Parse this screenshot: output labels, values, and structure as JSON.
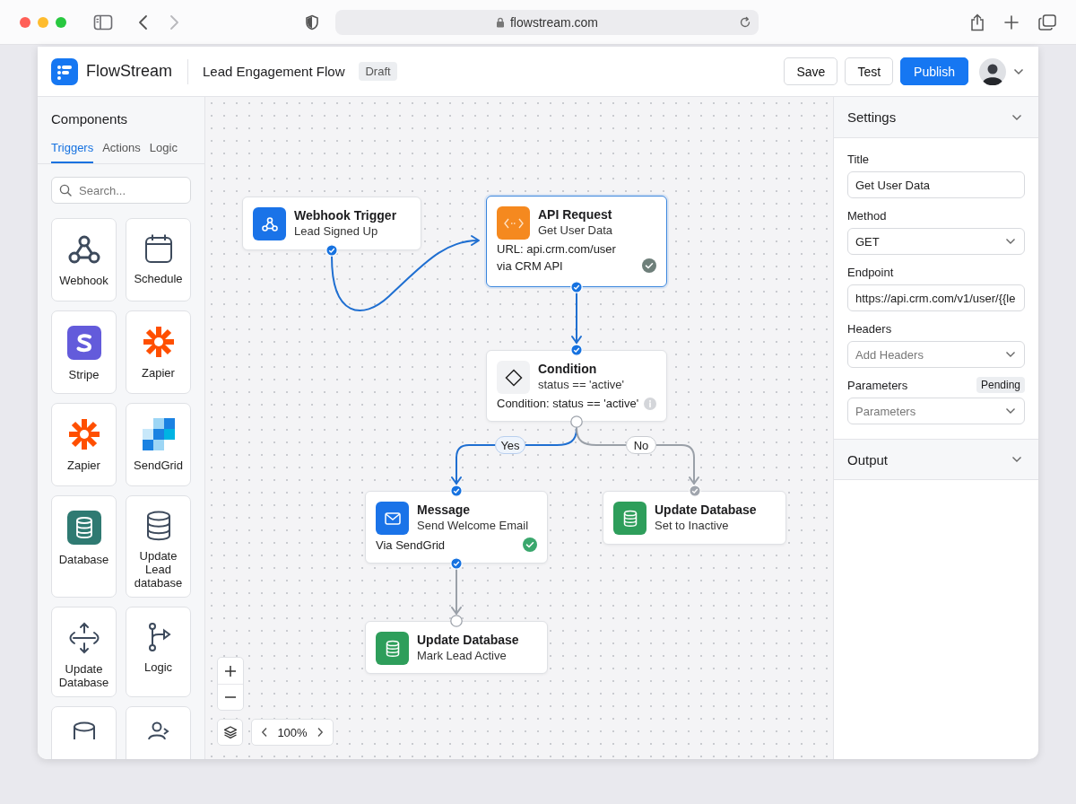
{
  "browser": {
    "url": "flowstream.com"
  },
  "app": {
    "name": "FlowStream",
    "flow_title": "Lead Engagement Flow",
    "status_badge": "Draft",
    "buttons": [
      {
        "label": "Save",
        "kind": "secondary"
      },
      {
        "label": "Test",
        "kind": "secondary"
      },
      {
        "label": "Publish",
        "kind": "primary"
      }
    ]
  },
  "components": {
    "title": "Components",
    "tabs": [
      {
        "label": "Triggers",
        "selected": true
      },
      {
        "label": "Actions",
        "selected": false
      },
      {
        "label": "Logic",
        "selected": false
      }
    ],
    "search": {
      "placeholder": "Search..."
    },
    "items": [
      {
        "label": "Webhook",
        "kind": "webhook"
      },
      {
        "label": "Schedule",
        "kind": "calendar"
      },
      {
        "label": "Stripe",
        "kind": "stripe"
      },
      {
        "label": "Zapier",
        "kind": "zapier"
      },
      {
        "label": "Zapier",
        "kind": "zapier"
      },
      {
        "label": "SendGrid",
        "kind": "sendgrid"
      },
      {
        "label": "Database",
        "kind": "database-tile"
      },
      {
        "label": "Update Lead database",
        "kind": "database"
      },
      {
        "label": "Update Database",
        "kind": "arrows"
      },
      {
        "label": "Logic",
        "kind": "branch"
      },
      {
        "kind": "cylinder"
      },
      {
        "kind": "user"
      }
    ]
  },
  "canvas": {
    "nodes": [
      {
        "title": "Webhook Trigger",
        "subtitle": "Lead Signed Up",
        "kind": "webhook",
        "color": "#1a73e8",
        "selected": false,
        "out_port": {
          "active": true,
          "checked": true
        }
      },
      {
        "title": "API Request",
        "subtitle": "Get User Data",
        "details": [
          "URL: api.crm.com/user",
          "via CRM API"
        ],
        "kind": "api",
        "color": "#f5891f",
        "status": {
          "kind": "check",
          "done": false
        },
        "selected": true,
        "out_port": {
          "active": true,
          "checked": true
        }
      },
      {
        "title": "Condition",
        "subtitle": "status == 'active'",
        "details": [
          "Condition: status == 'active'"
        ],
        "kind": "condition",
        "color": "#f1f2f4",
        "status": {
          "kind": "info"
        },
        "selected": false,
        "in_port": {
          "active": true,
          "checked": true
        },
        "out_port": {
          "active": false,
          "checked": false
        }
      },
      {
        "title": "Message",
        "subtitle": "Send Welcome Email",
        "details": [
          "Via SendGrid"
        ],
        "kind": "message",
        "color": "#1a73e8",
        "status": {
          "kind": "check",
          "done": true
        },
        "selected": false,
        "in_port": {
          "active": true,
          "checked": true
        },
        "out_port": {
          "active": true,
          "checked": true
        }
      },
      {
        "title": "Update Database",
        "subtitle": "Set to Inactive",
        "kind": "database",
        "color": "#2e9e5b",
        "selected": false,
        "in_port": {
          "active": false,
          "checked": true
        }
      },
      {
        "title": "Update Database",
        "subtitle": "Mark Lead Active",
        "kind": "database",
        "color": "#2e9e5b",
        "selected": false,
        "in_port": {
          "active": false,
          "checked": false
        }
      }
    ],
    "edges": [
      {
        "active": true
      },
      {
        "active": true
      },
      {
        "label": "Yes",
        "active": true
      },
      {
        "label": "No",
        "active": false
      },
      {
        "active": false
      }
    ],
    "zoom": "100%"
  },
  "settings": {
    "title": "Settings",
    "fields": [
      {
        "label": "Title",
        "kind": "input",
        "value": "Get User Data"
      },
      {
        "label": "Method",
        "kind": "select",
        "value": "GET"
      },
      {
        "label": "Endpoint",
        "kind": "input",
        "value": "https://api.crm.com/v1/user/{{le"
      },
      {
        "label": "Headers",
        "kind": "select",
        "placeholder": "Add Headers"
      },
      {
        "label": "Parameters",
        "kind": "select",
        "placeholder": "Parameters",
        "badge": "Pending"
      }
    ]
  },
  "output": {
    "title": "Output"
  }
}
